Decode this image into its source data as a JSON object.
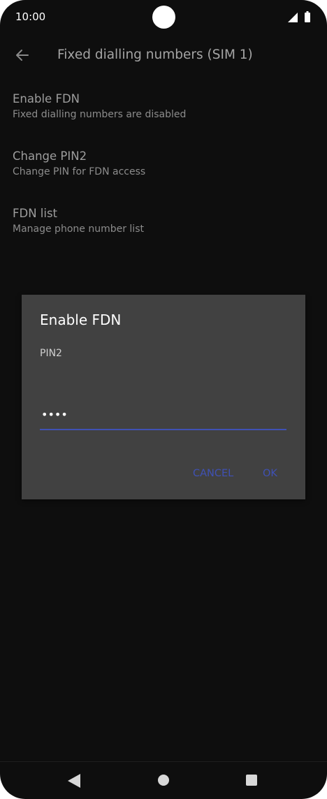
{
  "status_bar": {
    "time": "10:00",
    "icons": [
      "signal-icon",
      "battery-icon"
    ]
  },
  "app_bar": {
    "back_icon": "arrow-left-icon",
    "title": "Fixed dialling numbers (SIM 1)"
  },
  "settings": {
    "items": [
      {
        "title": "Enable FDN",
        "subtitle": "Fixed dialling numbers are disabled"
      },
      {
        "title": "Change PIN2",
        "subtitle": "Change PIN for FDN access"
      },
      {
        "title": "FDN list",
        "subtitle": "Manage phone number list"
      }
    ]
  },
  "dialog": {
    "title": "Enable FDN",
    "label": "PIN2",
    "pin_value": "••••",
    "cancel_label": "CANCEL",
    "ok_label": "OK"
  },
  "nav_bar": {
    "icons": [
      "nav-back-icon",
      "nav-home-icon",
      "nav-recents-icon"
    ]
  },
  "colors": {
    "background": "#0e0e0e",
    "dialog_background": "#414141",
    "accent": "#3f51b5"
  }
}
